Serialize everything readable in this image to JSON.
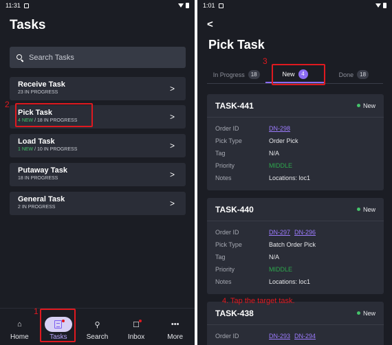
{
  "left": {
    "status": {
      "time": "11:31"
    },
    "title": "Tasks",
    "search": {
      "placeholder": "Search Tasks"
    },
    "tasks": [
      {
        "name": "Receive Task",
        "in_progress": "23 IN PROGRESS"
      },
      {
        "name": "Pick Task",
        "new": "4 NEW",
        "in_progress": " / 18 IN PROGRESS"
      },
      {
        "name": "Load Task",
        "new": "1 NEW",
        "in_progress": " / 10 IN PROGRESS"
      },
      {
        "name": "Putaway Task",
        "in_progress": "18 IN PROGRESS"
      },
      {
        "name": "General Task",
        "in_progress": "2 IN PROGRESS"
      }
    ],
    "nav": [
      {
        "label": "Home",
        "icon": "home-icon"
      },
      {
        "label": "Tasks",
        "icon": "tasks-icon"
      },
      {
        "label": "Search",
        "icon": "search-icon"
      },
      {
        "label": "Inbox",
        "icon": "inbox-icon"
      },
      {
        "label": "More",
        "icon": "more-icon"
      }
    ],
    "annotations": {
      "one": "1",
      "two": "2"
    }
  },
  "right": {
    "status": {
      "time": "1:01"
    },
    "back": "<",
    "title": "Pick Task",
    "tabs": [
      {
        "label": "In Progress",
        "count": "18"
      },
      {
        "label": "New",
        "count": "4"
      },
      {
        "label": "Done",
        "count": "18"
      }
    ],
    "field_labels": {
      "order_id": "Order ID",
      "pick_type": "Pick Type",
      "tag": "Tag",
      "priority": "Priority",
      "notes": "Notes"
    },
    "cards": [
      {
        "id": "TASK-441",
        "status": "New",
        "order_ids": [
          "DN-298"
        ],
        "pick_type": "Order Pick",
        "tag": "N/A",
        "priority": "MIDDLE",
        "notes": "Locations: loc1"
      },
      {
        "id": "TASK-440",
        "status": "New",
        "order_ids": [
          "DN-297",
          "DN-296"
        ],
        "pick_type": "Batch Order Pick",
        "tag": "N/A",
        "priority": "MIDDLE",
        "notes": "Locations: loc1"
      },
      {
        "id": "TASK-438",
        "status": "New",
        "order_ids": [
          "DN-293",
          "DN-294"
        ]
      }
    ],
    "annotations": {
      "three": "3",
      "four": "4. Tap the target task."
    }
  },
  "colors": {
    "accent": "#8b6cf6",
    "annotation": "#e0191f",
    "green": "#45c36a",
    "background": "#1b1d24",
    "card": "#2a2d37"
  }
}
